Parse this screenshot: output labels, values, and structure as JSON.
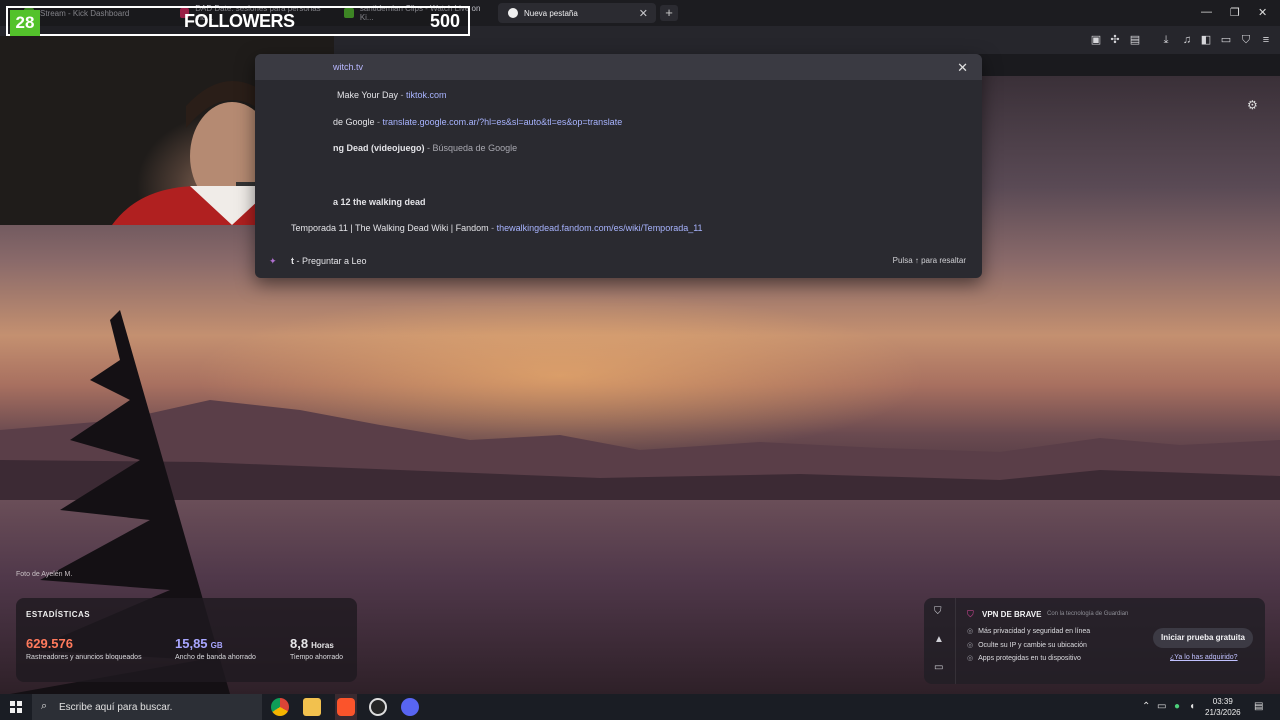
{
  "tabs": [
    {
      "title": "Stream - Kick Dashboard",
      "favicon_color": "#53c22b"
    },
    {
      "title": "DAD Date: sesiones para personas ma...",
      "favicon_color": "#e0245e"
    },
    {
      "title": "santidemian Clips - Watch Live on Ki...",
      "favicon_color": "#53c22b"
    },
    {
      "title": "Nueva pestaña",
      "favicon_color": "#f0f0f0",
      "active": true
    }
  ],
  "window_controls": {
    "minimize": "—",
    "maximize": "❐",
    "close": "✕"
  },
  "followers_widget": {
    "count": "28",
    "label": "FOLLOWERS",
    "goal": "500"
  },
  "omnibox_dropdown": {
    "input_text": "witch.tv",
    "close": "✕",
    "rows": [
      {
        "title": "Make Your Day",
        "sep": " - ",
        "url": "tiktok.com"
      },
      {
        "title": "de Google",
        "sep": " - ",
        "url": "translate.google.com.ar/?hl=es&sl=auto&tl=es&op=translate"
      },
      {
        "title": "ng Dead (videojuego)",
        "sep": " - ",
        "source": "Búsqueda de Google"
      },
      {
        "title": "a 12 the walking dead"
      },
      {
        "title": "Temporada 11 | The Walking Dead Wiki | Fandom",
        "sep": " - ",
        "url": "thewalkingdead.fandom.com/es/wiki/Temporada_11"
      }
    ],
    "leo_prefix": "t",
    "leo_text": " - Preguntar a Leo",
    "hint": "Pulsa ↑ para resaltar"
  },
  "photo_credit": "Foto de Ayelén M.",
  "stats": {
    "title": "ESTADÍSTICAS",
    "items": [
      {
        "value": "629.576",
        "unit": "",
        "caption": "Rastreadores y anuncios bloqueados",
        "color": "#ff7a5c"
      },
      {
        "value": "15,85",
        "unit": "GB",
        "caption": "Ancho de banda ahorrado",
        "color": "#a8a6ff"
      },
      {
        "value": "8,8",
        "unit": "Horas",
        "caption": "Tiempo ahorrado",
        "color": "#ffffff"
      }
    ]
  },
  "vpn": {
    "title": "VPN DE BRAVE",
    "tech": "Con la tecnología de Guardian",
    "bullets": [
      "Más privacidad y seguridad en línea",
      "Oculte su IP y cambie su ubicación",
      "Apps protegidas en tu dispositivo"
    ],
    "cta": "Iniciar prueba gratuita",
    "link": "¿Ya lo has adquirido?"
  },
  "taskbar": {
    "search_placeholder": "Escribe aquí para buscar.",
    "time": "03:39",
    "date": "21/3/2026"
  }
}
